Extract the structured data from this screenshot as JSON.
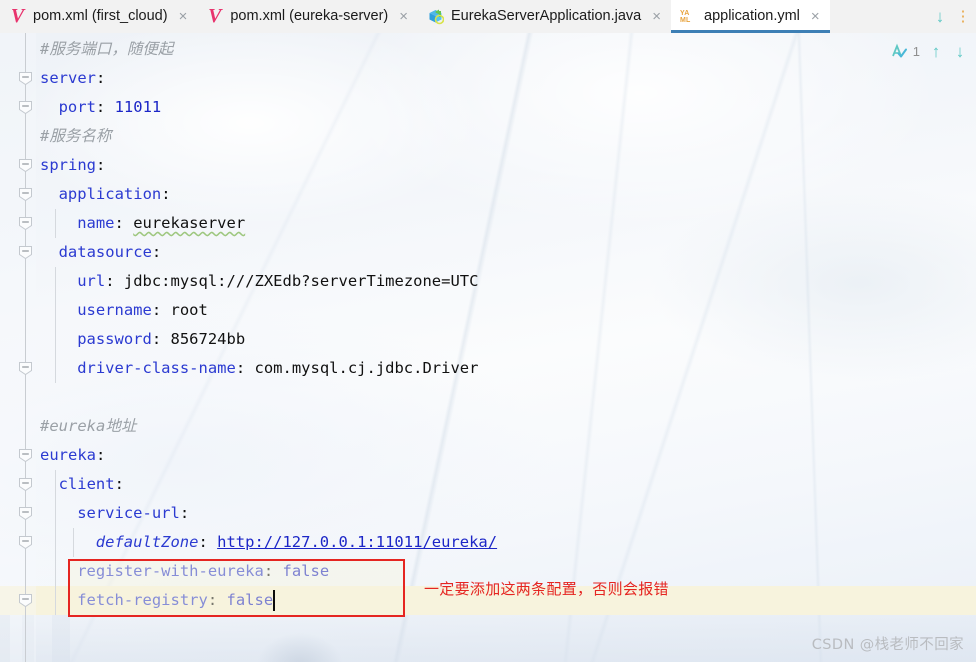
{
  "window": {
    "app": "IntelliJ IDEA editor"
  },
  "tabs": [
    {
      "label": "pom.xml (first_cloud)",
      "icon": "maven-icon",
      "active": false,
      "close": "×"
    },
    {
      "label": "pom.xml (eureka-server)",
      "icon": "maven-icon",
      "active": false,
      "close": "×"
    },
    {
      "label": "EurekaServerApplication.java",
      "icon": "spring-class-icon",
      "active": false,
      "close": "×"
    },
    {
      "label": "application.yml",
      "icon": "yaml-icon",
      "active": true,
      "close": "×"
    }
  ],
  "tabbar_actions": {
    "scroll_down_label": "↓",
    "overflow_label": "⋮"
  },
  "inspection": {
    "icon": "inspection-check-icon",
    "count": "1",
    "prev_label": "↑",
    "next_label": "↓"
  },
  "editor": {
    "file": "application.yml",
    "language": "YAML",
    "lines": [
      {
        "n": 1,
        "indent": 0,
        "type": "comment",
        "text": "#服务端口，随便起"
      },
      {
        "n": 2,
        "indent": 0,
        "type": "key",
        "key": "server",
        "value": ""
      },
      {
        "n": 3,
        "indent": 1,
        "type": "kv",
        "key": "port",
        "value": "11011",
        "value_kind": "number"
      },
      {
        "n": 4,
        "indent": 0,
        "type": "comment",
        "text": "#服务名称"
      },
      {
        "n": 5,
        "indent": 0,
        "type": "key",
        "key": "spring",
        "value": ""
      },
      {
        "n": 6,
        "indent": 1,
        "type": "key",
        "key": "application",
        "value": ""
      },
      {
        "n": 7,
        "indent": 2,
        "type": "kv",
        "key": "name",
        "value": "eurekaserver",
        "value_kind": "typo"
      },
      {
        "n": 8,
        "indent": 1,
        "type": "key",
        "key": "datasource",
        "value": ""
      },
      {
        "n": 9,
        "indent": 2,
        "type": "kv",
        "key": "url",
        "value": "jdbc:mysql:///ZXEdb?serverTimezone=UTC"
      },
      {
        "n": 10,
        "indent": 2,
        "type": "kv",
        "key": "username",
        "value": "root"
      },
      {
        "n": 11,
        "indent": 2,
        "type": "kv",
        "key": "password",
        "value": "856724bb"
      },
      {
        "n": 12,
        "indent": 2,
        "type": "kv",
        "key": "driver-class-name",
        "value": "com.mysql.cj.jdbc.Driver"
      },
      {
        "n": 13,
        "indent": 0,
        "type": "blank",
        "text": ""
      },
      {
        "n": 14,
        "indent": 0,
        "type": "comment",
        "text": "#eureka地址"
      },
      {
        "n": 15,
        "indent": 0,
        "type": "key",
        "key": "eureka",
        "value": ""
      },
      {
        "n": 16,
        "indent": 1,
        "type": "key",
        "key": "client",
        "value": ""
      },
      {
        "n": 17,
        "indent": 2,
        "type": "key",
        "key": "service-url",
        "value": ""
      },
      {
        "n": 18,
        "indent": 3,
        "type": "kv",
        "key": "defaultZone",
        "value": "http://127.0.0.1:11011/eureka/",
        "key_kind": "italic",
        "value_kind": "link"
      },
      {
        "n": 19,
        "indent": 2,
        "type": "kv",
        "key": "register-with-eureka",
        "value": "false",
        "value_kind": "boolean"
      },
      {
        "n": 20,
        "indent": 2,
        "type": "kv",
        "key": "fetch-registry",
        "value": "false",
        "value_kind": "boolean"
      }
    ],
    "fold_markers": [
      2,
      3,
      5,
      6,
      7,
      8,
      12,
      15,
      16,
      17,
      18,
      20
    ],
    "caret_line": 20,
    "caret_column_after": "false"
  },
  "annotation": {
    "text": "一定要添加这两条配置，否则会报错",
    "box_color": "#e52521",
    "text_color": "#e52521"
  },
  "watermark": {
    "text": "CSDN @栈老师不回家"
  },
  "colors": {
    "accent_tab_underline": "#3d7fb5",
    "key_blue": "#2b3ad1",
    "comment_gray": "#9aa0a6",
    "annotation_red": "#e52521",
    "caret_line": "#f7f3dd",
    "maven_pink": "#e8336d",
    "yaml_orange": "#e8a33d",
    "inspect_cyan": "#5ec8c4"
  }
}
